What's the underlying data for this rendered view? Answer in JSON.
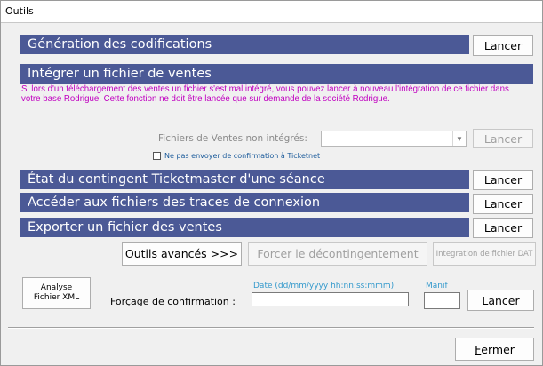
{
  "window": {
    "title": "Outils"
  },
  "sections": {
    "generation": {
      "title": "Génération des codifications",
      "button": "Lancer"
    },
    "integrer": {
      "title": "Intégrer un fichier de ventes"
    },
    "etat": {
      "title": "État du contingent Ticketmaster d'une séance",
      "button": "Lancer"
    },
    "acceder": {
      "title": "Accéder aux fichiers des traces de connexion",
      "button": "Lancer"
    },
    "exporter": {
      "title": "Exporter un fichier des ventes",
      "button": "Lancer"
    }
  },
  "integration": {
    "info_text": "Si lors d'un téléchargement des ventes un fichier s'est mal intégré, vous pouvez lancer à nouveau l'intégration de ce fichier dans votre base Rodrigue. Cette fonction ne doit être lancée que sur demande de la société Rodrigue.",
    "files_label": "Fichiers de Ventes non intégrés:",
    "files_value": "",
    "button": "Lancer",
    "checkbox_label": "Ne pas envoyer de confirmation à Ticketnet",
    "checkbox_checked": false
  },
  "tools_row": {
    "outils_avances": "Outils avancés >>>",
    "forcer": "Forcer le décontingentement",
    "integration_dat": "Integration de fichier DAT"
  },
  "forcage": {
    "analyse_line1": "Analyse",
    "analyse_line2": "Fichier XML",
    "label": "Forçage de confirmation :",
    "date_hint": "Date (dd/mm/yyyy hh:nn:ss:mmm)",
    "date_value": "",
    "manif_hint": "Manif",
    "manif_value": "",
    "button": "Lancer"
  },
  "footer": {
    "close_first": "F",
    "close_rest": "ermer"
  }
}
